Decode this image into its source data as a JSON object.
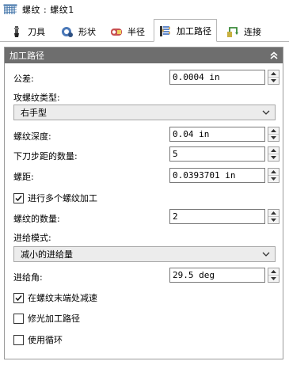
{
  "window": {
    "title": "螺纹 : 螺纹1"
  },
  "tabs": [
    {
      "label": "刀具",
      "icon": "cutter-icon"
    },
    {
      "label": "形状",
      "icon": "shape-icon"
    },
    {
      "label": "半径",
      "icon": "radius-icon"
    },
    {
      "label": "加工路径",
      "icon": "toolpath-icon",
      "active": true
    },
    {
      "label": "连接",
      "icon": "link-icon"
    }
  ],
  "panel": {
    "title": "加工路径",
    "tolerance": {
      "label": "公差:",
      "value": "0.0004 in"
    },
    "thread_type": {
      "label": "攻螺纹类型:",
      "selected": "右手型"
    },
    "thread_depth": {
      "label": "螺纹深度:",
      "value": "0.04 in"
    },
    "num_steps": {
      "label": "下刀步距的数量:",
      "value": "5"
    },
    "pitch": {
      "label": "螺距:",
      "value": "0.0393701 in"
    },
    "multi_thread": {
      "label": "进行多个螺纹加工",
      "checked": true
    },
    "num_threads": {
      "label": "螺纹的数量:",
      "value": "2"
    },
    "feed_mode": {
      "label": "进给模式:",
      "selected": "减小的进给量"
    },
    "feed_angle": {
      "label": "进给角:",
      "value": "29.5 deg"
    },
    "decel_at_end": {
      "label": "在螺纹末端处减速",
      "checked": true
    },
    "finish_path": {
      "label": "修光加工路径",
      "checked": false
    },
    "use_loop": {
      "label": "使用循环",
      "checked": false
    }
  }
}
